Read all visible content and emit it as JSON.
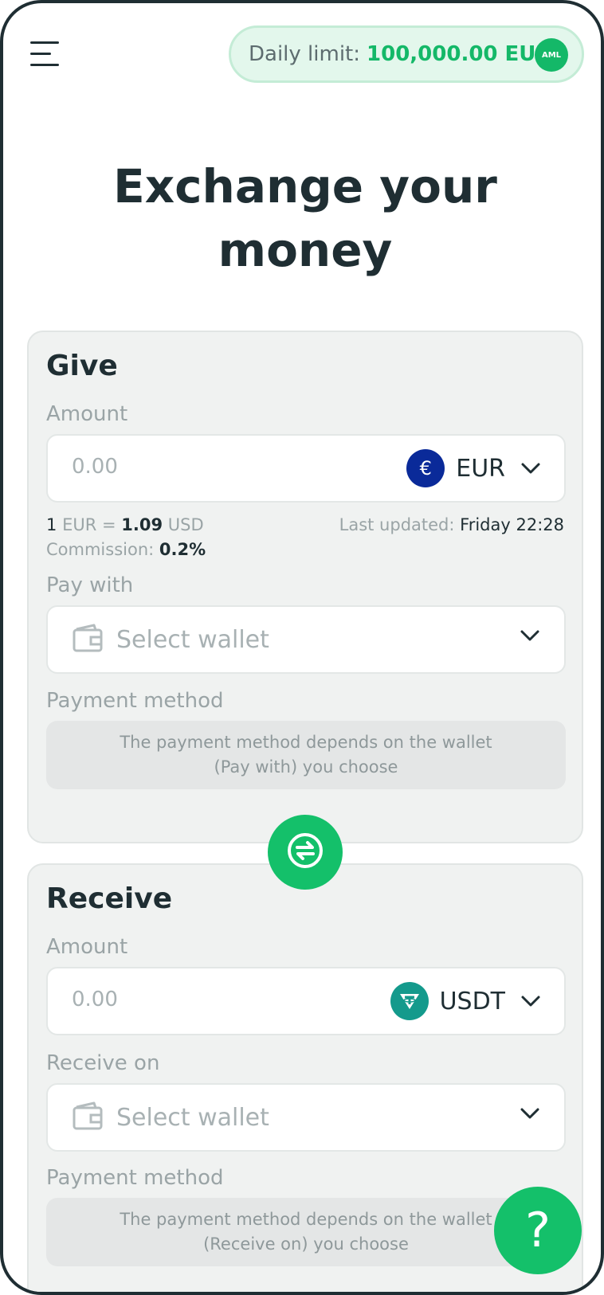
{
  "header": {
    "daily_limit_label": "Daily limit:",
    "daily_limit_value": "100,000.00 EUR",
    "aml_badge": "AML"
  },
  "page_title_line1": "Exchange your",
  "page_title_line2": "money",
  "give": {
    "title": "Give",
    "amount_label": "Amount",
    "amount_value": "0.00",
    "currency": "EUR",
    "currency_symbol": "€",
    "currency_icon": "euro-icon",
    "currency_color": "#0a2a99",
    "rate": {
      "from_amount": "1",
      "from_currency": "EUR",
      "equals": "=",
      "to_amount": "1.09",
      "to_currency": "USD"
    },
    "last_updated_label": "Last updated:",
    "last_updated_value": "Friday 22:28",
    "commission_label": "Commission:",
    "commission_value": "0.2%",
    "pay_with_label": "Pay with",
    "wallet_placeholder": "Select wallet",
    "payment_method_label": "Payment method",
    "payment_method_line1": "The payment method depends on the wallet",
    "payment_method_line2": "(Pay with) you choose"
  },
  "receive": {
    "title": "Receive",
    "amount_label": "Amount",
    "amount_value": "0.00",
    "currency": "USDT",
    "currency_icon": "tether-icon",
    "currency_color": "#149a8c",
    "receive_on_label": "Receive on",
    "wallet_placeholder": "Select wallet",
    "payment_method_label": "Payment method",
    "payment_method_line1": "The payment method depends on the wallet",
    "payment_method_line2": "(Receive on) you choose"
  },
  "help_button_glyph": "?",
  "colors": {
    "accent": "#14c06a",
    "text_dark": "#1f2e33",
    "text_muted": "#9aa4a6",
    "card_bg": "#f0f2f1"
  }
}
